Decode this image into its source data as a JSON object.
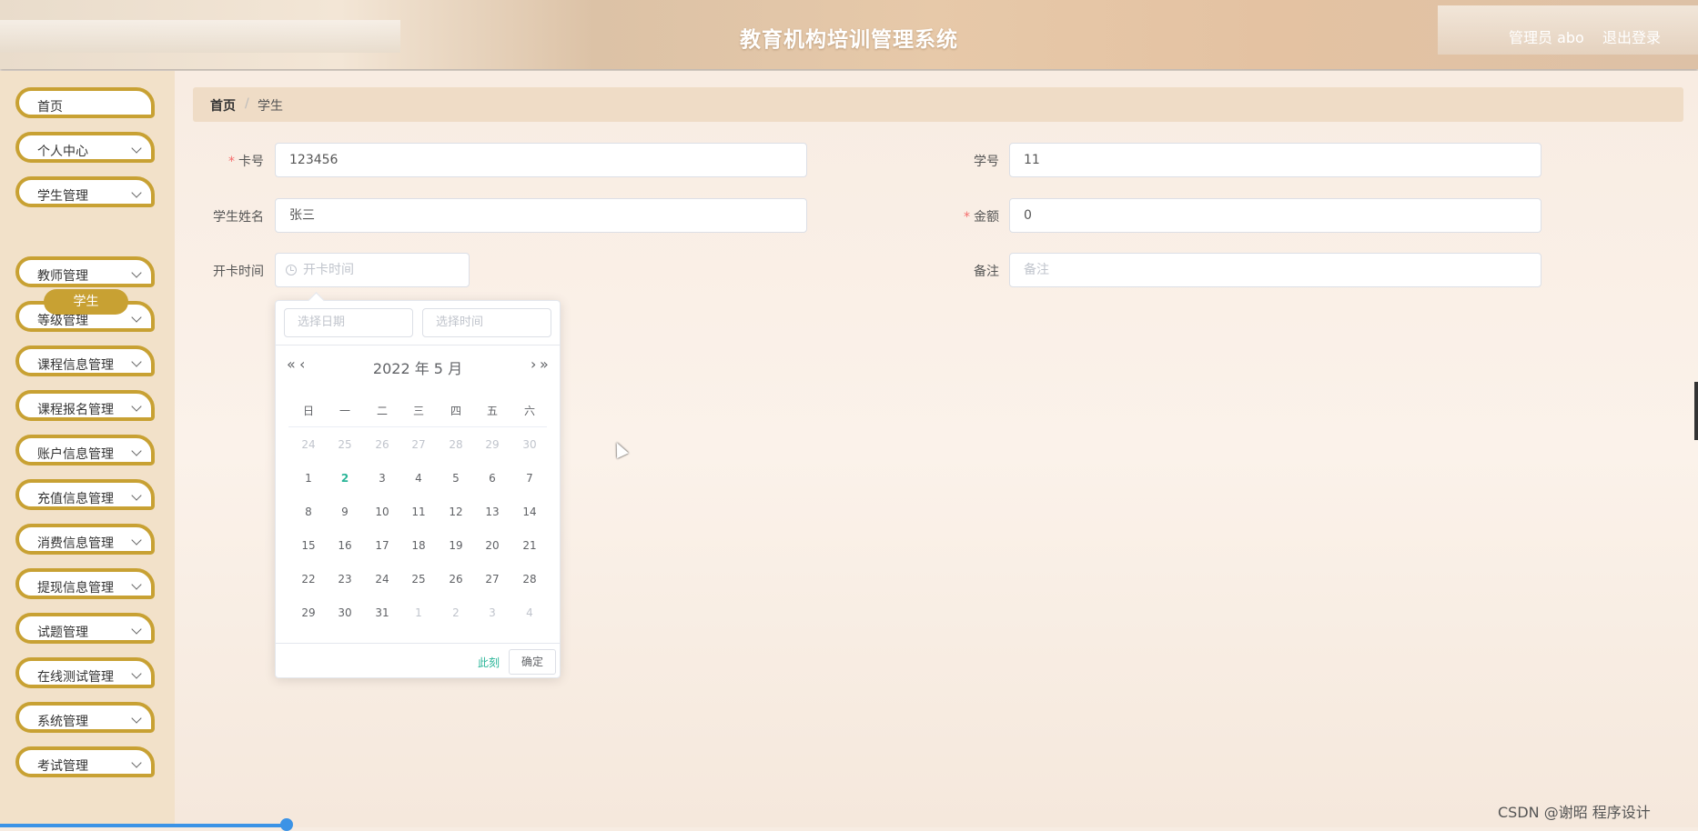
{
  "header": {
    "title": "教育机构培训管理系统",
    "admin_label": "管理员 abo",
    "logout_label": "退出登录"
  },
  "sidebar": {
    "items": [
      {
        "label": "首页",
        "expandable": false
      },
      {
        "label": "个人中心",
        "expandable": true
      },
      {
        "label": "学生管理",
        "expandable": true
      },
      {
        "label": "教师管理",
        "expandable": true
      },
      {
        "label": "等级管理",
        "expandable": true
      },
      {
        "label": "课程信息管理",
        "expandable": true
      },
      {
        "label": "课程报名管理",
        "expandable": true
      },
      {
        "label": "账户信息管理",
        "expandable": true
      },
      {
        "label": "充值信息管理",
        "expandable": true
      },
      {
        "label": "消费信息管理",
        "expandable": true
      },
      {
        "label": "提现信息管理",
        "expandable": true
      },
      {
        "label": "试题管理",
        "expandable": true
      },
      {
        "label": "在线测试管理",
        "expandable": true
      },
      {
        "label": "系统管理",
        "expandable": true
      },
      {
        "label": "考试管理",
        "expandable": true
      }
    ],
    "active_sub": "学生"
  },
  "breadcrumb": {
    "home": "首页",
    "separator": "/",
    "current": "学生"
  },
  "form": {
    "card_no": {
      "label": "卡号",
      "required": true,
      "value": "123456"
    },
    "student_id": {
      "label": "学号",
      "required": false,
      "value": "11"
    },
    "student_name": {
      "label": "学生姓名",
      "required": false,
      "value": "张三"
    },
    "amount": {
      "label": "金额",
      "required": true,
      "value": "0"
    },
    "open_time": {
      "label": "开卡时间",
      "required": false,
      "value": "",
      "placeholder": "开卡时间"
    },
    "remark": {
      "label": "备注",
      "required": false,
      "value": "",
      "placeholder": "备注"
    }
  },
  "datepicker": {
    "date_placeholder": "选择日期",
    "time_placeholder": "选择时间",
    "year_month": "2022 年  5 月",
    "nav": {
      "prev_year": "«",
      "prev_month": "‹",
      "next_month": "›",
      "next_year": "»"
    },
    "weekdays": [
      "日",
      "一",
      "二",
      "三",
      "四",
      "五",
      "六"
    ],
    "weeks": [
      [
        "24",
        "25",
        "26",
        "27",
        "28",
        "29",
        "30"
      ],
      [
        "1",
        "2",
        "3",
        "4",
        "5",
        "6",
        "7"
      ],
      [
        "8",
        "9",
        "10",
        "11",
        "12",
        "13",
        "14"
      ],
      [
        "15",
        "16",
        "17",
        "18",
        "19",
        "20",
        "21"
      ],
      [
        "22",
        "23",
        "24",
        "25",
        "26",
        "27",
        "28"
      ],
      [
        "29",
        "30",
        "31",
        "1",
        "2",
        "3",
        "4"
      ]
    ],
    "today": "2",
    "now_label": "此刻",
    "confirm_label": "确定"
  },
  "watermark": "CSDN @谢昭  程序设计",
  "colors": {
    "accent_gold": "#c8a133",
    "today_green": "#2ab598",
    "required_red": "#f56c6c"
  }
}
